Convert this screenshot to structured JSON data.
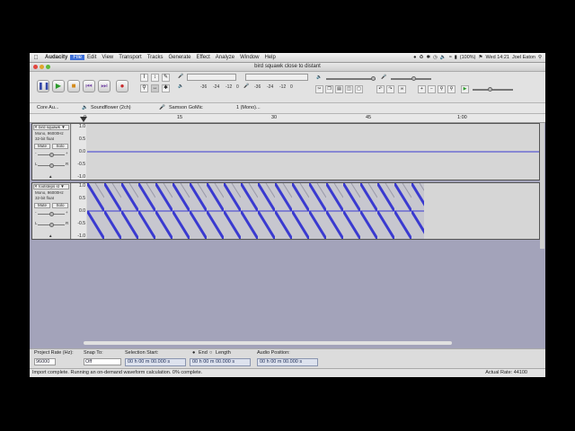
{
  "menubar": {
    "app": "Audacity",
    "items": [
      "File",
      "Edit",
      "View",
      "Transport",
      "Tracks",
      "Generate",
      "Effect",
      "Analyze",
      "Window",
      "Help"
    ],
    "battery": "(100%)",
    "clock": "Wed 14:21",
    "user": "Joel Eaton"
  },
  "window": {
    "title": "bird squawk close to distant"
  },
  "meters": {
    "record_ticks": [
      "-36",
      "-24",
      "-12",
      "0"
    ],
    "play_ticks": [
      "-36",
      "-24",
      "-12",
      "0"
    ],
    "play_ticks_b": [
      "-36",
      "-24",
      "-12",
      "0"
    ]
  },
  "devices": {
    "host": "Core Au...",
    "output": "Soundflower (2ch)",
    "input": "Samson GoMic",
    "channels": "1 (Mono)..."
  },
  "ruler": {
    "ticks": [
      "0",
      "15",
      "30",
      "45",
      "1:00"
    ]
  },
  "tracks": [
    {
      "name": "bird squawk",
      "info": [
        "Mono, 96000Hz",
        "32-bit float"
      ],
      "mute": "Mute",
      "solo": "Solo",
      "scale": [
        "1.0",
        "0.5",
        "0.0",
        "-0.5",
        "-1.0"
      ]
    },
    {
      "name": "footsteps st",
      "info": [
        "Mono, 96000Hz",
        "32-bit float"
      ],
      "mute": "Mute",
      "solo": "Solo",
      "scale": [
        "1.0",
        "0.5",
        "0.0",
        "-0.5",
        "-1.0"
      ]
    }
  ],
  "pan_labels": {
    "left": "L",
    "right": "R"
  },
  "gain_labels": {
    "minus": "-",
    "plus": "+"
  },
  "selection": {
    "rate_label": "Project Rate (Hz):",
    "rate_value": "96000",
    "snap_label": "Snap To:",
    "snap_value": "Off",
    "start_label": "Selection Start:",
    "end_label": "End",
    "length_label": "Length",
    "start_value": "00 h 00 m 00.000 s",
    "end_value": "00 h 00 m 00.000 s",
    "position_label": "Audio Position:",
    "position_value": "00 h 00 m 00.000 s"
  },
  "status": {
    "message": "Import complete. Running an on-demand waveform calculation.  0% complete.",
    "rate": "Actual Rate: 44100"
  },
  "colors": {
    "wave": "#3a3ad0",
    "track_bg": "#d6d6d6",
    "project_bg": "#a3a3ba",
    "accent": "#3d6fd9"
  }
}
